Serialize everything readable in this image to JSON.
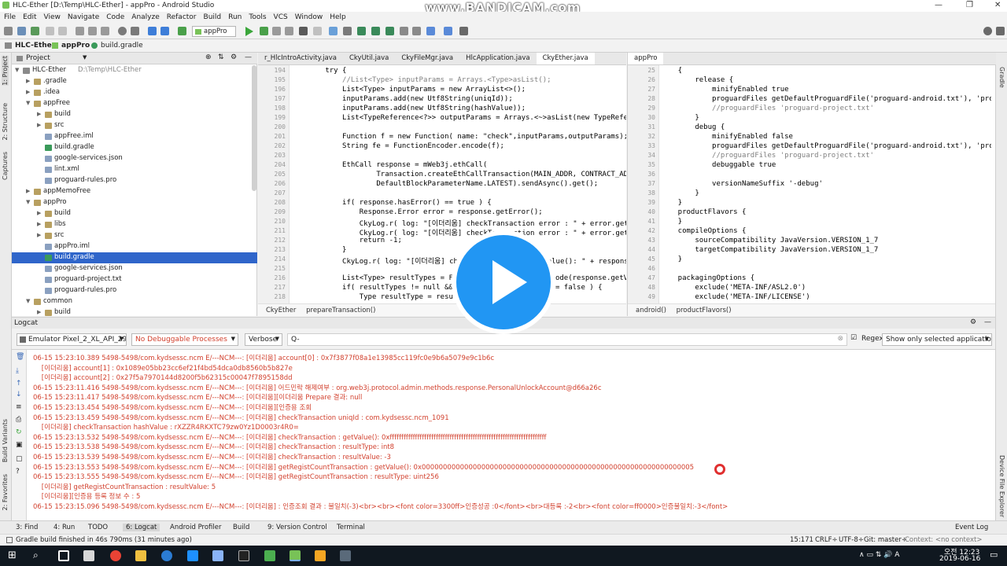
{
  "window": {
    "title": "HLC-Ether [D:\\Temp\\HLC-Ether] - appPro - Android Studio",
    "watermark": "www.BANDICAM.com"
  },
  "menu": [
    "File",
    "Edit",
    "View",
    "Navigate",
    "Code",
    "Analyze",
    "Refactor",
    "Build",
    "Run",
    "Tools",
    "VCS",
    "Window",
    "Help"
  ],
  "toolbar": {
    "run_config": "appPro"
  },
  "breadcrumb": [
    "HLC-Ether",
    "appPro",
    "build.gradle"
  ],
  "project": {
    "title": "Project",
    "tree": [
      {
        "label": "HLC-Ether",
        "extra": "D:\\Temp\\HLC-Ether",
        "depth": 0,
        "arrow": "▼",
        "kind": "module"
      },
      {
        "label": ".gradle",
        "depth": 1,
        "arrow": "▶",
        "kind": "folder"
      },
      {
        "label": ".idea",
        "depth": 1,
        "arrow": "▶",
        "kind": "folder"
      },
      {
        "label": "appFree",
        "depth": 1,
        "arrow": "▼",
        "kind": "folder"
      },
      {
        "label": "build",
        "depth": 2,
        "arrow": "▶",
        "kind": "folder"
      },
      {
        "label": "src",
        "depth": 2,
        "arrow": "▶",
        "kind": "folder"
      },
      {
        "label": "appFree.iml",
        "depth": 2,
        "arrow": "",
        "kind": "file"
      },
      {
        "label": "build.gradle",
        "depth": 2,
        "arrow": "",
        "kind": "gradle"
      },
      {
        "label": "google-services.json",
        "depth": 2,
        "arrow": "",
        "kind": "file"
      },
      {
        "label": "lint.xml",
        "depth": 2,
        "arrow": "",
        "kind": "file"
      },
      {
        "label": "proguard-rules.pro",
        "depth": 2,
        "arrow": "",
        "kind": "file"
      },
      {
        "label": "appMemoFree",
        "depth": 1,
        "arrow": "▶",
        "kind": "folder"
      },
      {
        "label": "appPro",
        "depth": 1,
        "arrow": "▼",
        "kind": "folder"
      },
      {
        "label": "build",
        "depth": 2,
        "arrow": "▶",
        "kind": "folder"
      },
      {
        "label": "libs",
        "depth": 2,
        "arrow": "▶",
        "kind": "folder"
      },
      {
        "label": "src",
        "depth": 2,
        "arrow": "▶",
        "kind": "folder"
      },
      {
        "label": "appPro.iml",
        "depth": 2,
        "arrow": "",
        "kind": "file"
      },
      {
        "label": "build.gradle",
        "depth": 2,
        "arrow": "",
        "kind": "gradle",
        "selected": true
      },
      {
        "label": "google-services.json",
        "depth": 2,
        "arrow": "",
        "kind": "file"
      },
      {
        "label": "proguard-project.txt",
        "depth": 2,
        "arrow": "",
        "kind": "file"
      },
      {
        "label": "proguard-rules.pro",
        "depth": 2,
        "arrow": "",
        "kind": "file"
      },
      {
        "label": "common",
        "depth": 1,
        "arrow": "▼",
        "kind": "folder"
      },
      {
        "label": "build",
        "depth": 2,
        "arrow": "▶",
        "kind": "folder"
      }
    ]
  },
  "editor_left": {
    "tabs": [
      "r_HlcIntroActivity.java",
      "CkyUtil.java",
      "CkyFileMgr.java",
      "HlcApplication.java",
      "CkyEther.java"
    ],
    "active_tab": 4,
    "first_line": 194,
    "lines": [
      "        try {",
      "            //List<Type> inputParams = Arrays.<Type>asList();",
      "            List<Type> inputParams = new ArrayList<>();",
      "            inputParams.add(new Utf8String(uniqId));",
      "            inputParams.add(new Utf8String(hashValue));",
      "            List<TypeReference<?>> outputParams = Arrays.<~>asList(new TypeRefe",
      "",
      "            Function f = new Function( name: \"check\",inputParams,outputParams);",
      "            String fe = FunctionEncoder.encode(f);",
      "",
      "            EthCall response = mWeb3j.ethCall(",
      "                    Transaction.createEthCallTransaction(MAIN_ADDR, CONTRACT_AD",
      "                    DefaultBlockParameterName.LATEST).sendAsync().get();",
      "",
      "            if( response.hasError() == true ) {",
      "                Response.Error error = response.getError();",
      "                CkyLog.r( log: \"[이더리움] checkTransaction error : \" + error.get",
      "                CkyLog.r( log: \"[이더리움] checkTransaction error : \" + error.get",
      "                return -1;",
      "            }",
      "            CkyLog.r( log: \"[이더리움] checkTransaction : getValue(): \" + respons",
      "",
      "            List<Type> resultTypes = FunctionReturnDecoder.decode(response.getV",
      "            if( resultTypes != null && resultTypes.isEmpty() == false ) {",
      "                Type resultType = resultTypes.get(0);"
    ],
    "breadcrumb": [
      "CkyEther",
      "prepareTransaction()"
    ]
  },
  "editor_right": {
    "tabs": [
      "appPro"
    ],
    "active_tab": 0,
    "first_line": 25,
    "lines": [
      "    {",
      "        release {",
      "            minifyEnabled true",
      "            proguardFiles getDefaultProguardFile('proguard-android.txt'), 'progu",
      "            //proguardFiles 'proguard-project.txt'",
      "        }",
      "        debug {",
      "            minifyEnabled false",
      "            proguardFiles getDefaultProguardFile('proguard-android.txt'), 'progu",
      "            //proguardFiles 'proguard-project.txt'",
      "            debuggable true",
      "",
      "            versionNameSuffix '-debug'",
      "        }",
      "    }",
      "    productFlavors {",
      "    }",
      "    compileOptions {",
      "        sourceCompatibility JavaVersion.VERSION_1_7",
      "        targetCompatibility JavaVersion.VERSION_1_7",
      "    }",
      "",
      "    packagingOptions {",
      "        exclude('META-INF/ASL2.0')",
      "        exclude('META-INF/LICENSE')"
    ],
    "breadcrumb": [
      "android()",
      "productFlavors()"
    ]
  },
  "logcat": {
    "title": "Logcat",
    "device": "Emulator Pixel_2_XL_API_29",
    "process": "No Debuggable Processes",
    "level": "Verbose",
    "search_placeholder": "Q-",
    "regex_label": "Regex",
    "filter": "Show only selected application",
    "lines": [
      "06-15 15:23:10.389 5498-5498/com.kydsessc.ncm E/---NCM---: [이더리움] account[0] : 0x7f3877f08a1e13985cc119fc0e9b6a5079e9c1b6c",
      "    [이더리움] account[1] : 0x1089e05bb23cc6ef21f4bd54dca0db8560b5b827e",
      "    [이더리움] account[2] : 0x27f5a7970144d8200f5b62315c00047f7895158dd",
      "06-15 15:23:11.416 5498-5498/com.kydsessc.ncm E/---NCM---: [이더리움] 어드민락 해제여부 : org.web3j.protocol.admin.methods.response.PersonalUnlockAccount@d66a26c",
      "06-15 15:23:11.417 5498-5498/com.kydsessc.ncm E/---NCM---: [이더리움][이더리움 Prepare 결과: null",
      "06-15 15:23:13.454 5498-5498/com.kydsessc.ncm E/---NCM---: [이더리움][인증용 조회",
      "06-15 15:23:13.459 5498-5498/com.kydsessc.ncm E/---NCM---: [이더리움] checkTransaction uniqId : com.kydsessc.ncm_1091",
      "    [이더리움] checkTransaction hashValue : rXZZR4RKXTC79zw0Yz1D0003r4R0=",
      "06-15 15:23:13.532 5498-5498/com.kydsessc.ncm E/---NCM---: [이더리움] checkTransaction : getValue(): 0xffffffffffffffffffffffffffffffffffffffffffffffffffffffffffffffffffff",
      "06-15 15:23:13.538 5498-5498/com.kydsessc.ncm E/---NCM---: [이더리움] checkTransaction : resultType: int8",
      "06-15 15:23:13.539 5498-5498/com.kydsessc.ncm E/---NCM---: [이더리움] checkTransaction : resultValue: -3",
      "06-15 15:23:13.553 5498-5498/com.kydsessc.ncm E/---NCM---: [이더리움] getRegistCountTransaction : getValue(): 0x0000000000000000000000000000000000000000000000000000000000000005",
      "06-15 15:23:13.555 5498-5498/com.kydsessc.ncm E/---NCM---: [이더리움] getRegistCountTransaction : resultType: uint256",
      "    [이더리움] getRegistCountTransaction : resultValue: 5",
      "    [이더리움][인증용 등록 정보 수 : 5",
      "06-15 15:23:15.096 5498-5498/com.kydsessc.ncm E/---NCM---: [이더리움] : 인증조회 결과 : 불일치(-3)<br><br><font color=3300ff>인증성공 :0</font><br>대등록 :-2<br><font color=ff0000>인증불일치:-3</font>"
    ]
  },
  "bottom_tabs": [
    "3: Find",
    "4: Run",
    "TODO",
    "6: Logcat",
    "Android Profiler",
    "Build",
    "9: Version Control",
    "Terminal"
  ],
  "event_log": "Event Log",
  "status": {
    "message": "Gradle build finished in 46s 790ms (31 minutes ago)",
    "position": "15:171",
    "line_sep": "CRLF÷",
    "encoding": "UTF-8÷",
    "git": "Git: master÷",
    "context": "Context: <no context>"
  },
  "side_labels": {
    "left": [
      "1: Project",
      "2: Structure",
      "Captures",
      "Build Variants",
      "2: Favorites"
    ],
    "right": [
      "Gradle",
      "Device File Explorer"
    ]
  },
  "taskbar": {
    "time": "오전 12:23",
    "date": "2019-06-16"
  },
  "colors": {
    "selection": "#2f65ca",
    "log_error": "#d2412e",
    "keyword": "#000080",
    "string": "#008000",
    "play": "#2196f3"
  }
}
